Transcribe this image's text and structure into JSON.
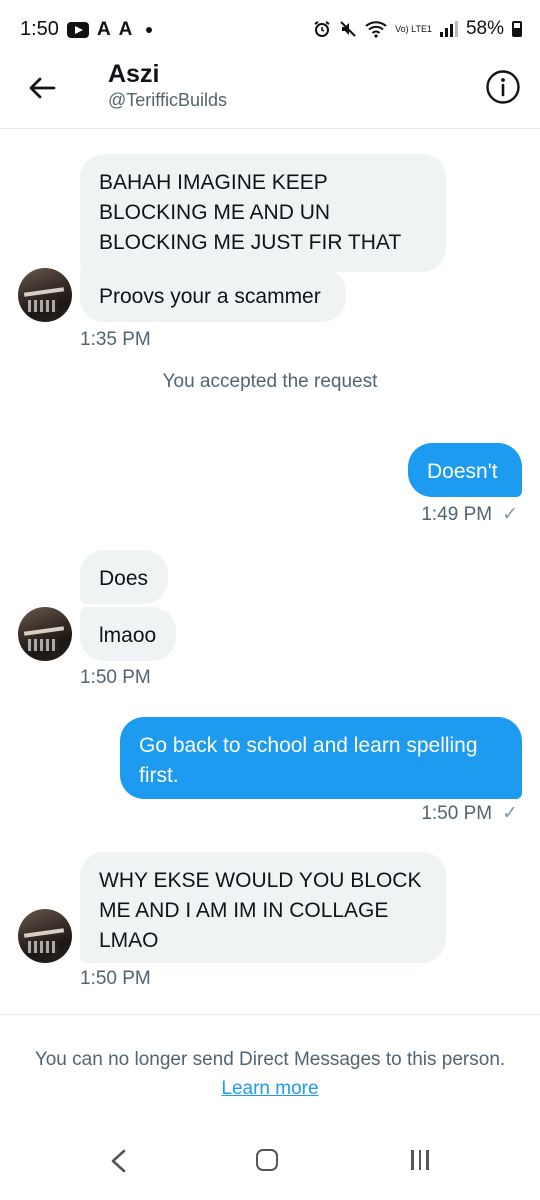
{
  "status_bar": {
    "time": "1:50",
    "icons": [
      "youtube-icon",
      "a-icon",
      "a-icon",
      "dot-icon"
    ],
    "network": "Vo) LTE1",
    "battery": "58%"
  },
  "header": {
    "name": "Aszi",
    "handle": "@TerifficBuilds"
  },
  "messages": {
    "m1": "BAHAH IMAGINE KEEP BLOCKING ME AND UN BLOCKING ME JUST FIR THAT",
    "m2": "Proovs your a scammer",
    "t1": "1:35 PM",
    "system": "You accepted the request",
    "m3": "Doesn't",
    "t2": "1:49 PM",
    "m4": "Does",
    "m5": "lmaoo",
    "t3": "1:50 PM",
    "m6": "Go back to school and learn spelling first.",
    "t4": "1:50 PM",
    "m7": "WHY EKSE WOULD YOU BLOCK ME AND I AM IM IN COLLAGE LMAO",
    "t5": "1:50 PM"
  },
  "footer": {
    "notice": "You can no longer send Direct Messages to this person.",
    "link": "Learn more"
  },
  "colors": {
    "accent": "#1d9bf0",
    "incoming_bg": "#eff3f4",
    "secondary_text": "#536471"
  }
}
